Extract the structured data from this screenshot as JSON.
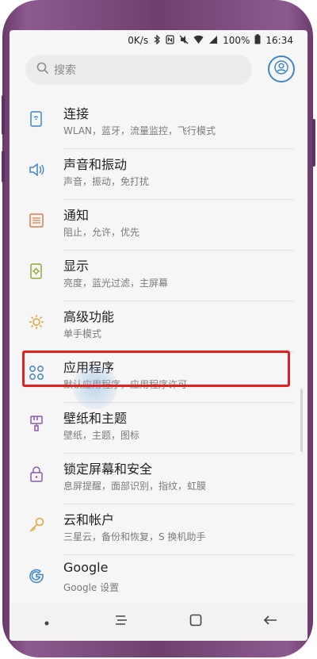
{
  "status_bar": {
    "network_speed": "0K/s",
    "battery": "100%",
    "time": "16:34",
    "icons": [
      "bluetooth-icon",
      "nfc-icon",
      "mute-icon",
      "wifi-icon",
      "signal-icon",
      "battery-icon"
    ]
  },
  "search": {
    "placeholder": "搜索",
    "profile_icon": "account-icon"
  },
  "settings_items": [
    {
      "title": "连接",
      "subtitle": "WLAN，蓝牙，流量监控，飞行模式",
      "icon": "connections-icon"
    },
    {
      "title": "声音和振动",
      "subtitle": "声音，振动，免打扰",
      "icon": "sound-icon"
    },
    {
      "title": "通知",
      "subtitle": "阻止，允许，优先",
      "icon": "notifications-icon"
    },
    {
      "title": "显示",
      "subtitle": "亮度，蓝光过滤，主屏幕",
      "icon": "display-icon"
    },
    {
      "title": "高级功能",
      "subtitle": "单手模式",
      "icon": "advanced-icon"
    },
    {
      "title": "应用程序",
      "subtitle": "默认应用程序，应用程序许可",
      "icon": "apps-icon"
    },
    {
      "title": "壁纸和主题",
      "subtitle": "壁纸，主题，图标",
      "icon": "wallpaper-icon"
    },
    {
      "title": "锁定屏幕和安全",
      "subtitle": "息屏提醒，面部识别，指纹，虹膜",
      "icon": "lock-icon"
    },
    {
      "title": "云和帐户",
      "subtitle": "三星云，备份和恢复，S 换机助手",
      "icon": "key-icon"
    },
    {
      "title": "Google",
      "subtitle": "Google 设置",
      "icon": "google-icon"
    }
  ],
  "colors": {
    "accent": "#3f86c6",
    "highlight": "#e32020",
    "frame": "#7a4a7c"
  },
  "nav_bar": {
    "icons": [
      "dot-icon",
      "recents-icon",
      "home-icon",
      "back-icon"
    ]
  }
}
